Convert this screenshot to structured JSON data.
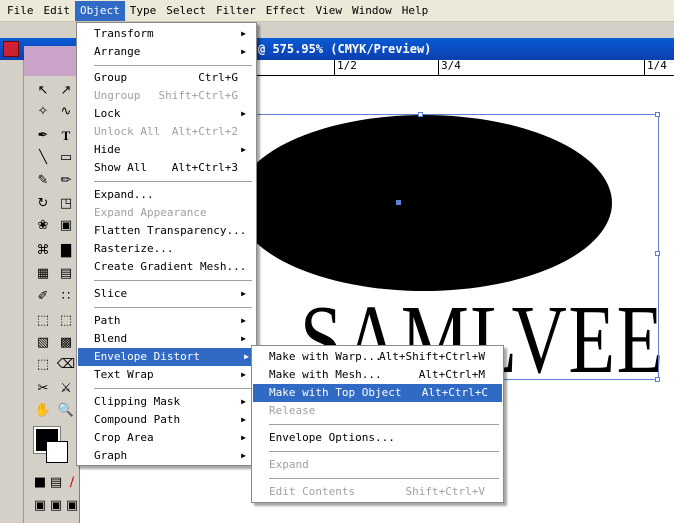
{
  "menubar": {
    "items": [
      "File",
      "Edit",
      "Object",
      "Type",
      "Select",
      "Filter",
      "Effect",
      "View",
      "Window",
      "Help"
    ],
    "active": "Object"
  },
  "document": {
    "title": "@ 575.95% (CMYK/Preview)",
    "ruler_labels": [
      "1/2",
      "3/4",
      "1/4"
    ],
    "canvas_text": "SAMLVEE"
  },
  "object_menu": {
    "items": [
      {
        "label": "Transform",
        "shortcut": "",
        "submenu": true,
        "disabled": false
      },
      {
        "label": "Arrange",
        "shortcut": "",
        "submenu": true,
        "disabled": false
      },
      {
        "label": "Group",
        "shortcut": "Ctrl+G",
        "submenu": false,
        "disabled": false
      },
      {
        "label": "Ungroup",
        "shortcut": "Shift+Ctrl+G",
        "submenu": false,
        "disabled": true
      },
      {
        "label": "Lock",
        "shortcut": "",
        "submenu": true,
        "disabled": false
      },
      {
        "label": "Unlock All",
        "shortcut": "Alt+Ctrl+2",
        "submenu": false,
        "disabled": true
      },
      {
        "label": "Hide",
        "shortcut": "",
        "submenu": true,
        "disabled": false
      },
      {
        "label": "Show All",
        "shortcut": "Alt+Ctrl+3",
        "submenu": false,
        "disabled": false
      },
      {
        "label": "Expand...",
        "shortcut": "",
        "submenu": false,
        "disabled": false
      },
      {
        "label": "Expand Appearance",
        "shortcut": "",
        "submenu": false,
        "disabled": true
      },
      {
        "label": "Flatten Transparency...",
        "shortcut": "",
        "submenu": false,
        "disabled": false
      },
      {
        "label": "Rasterize...",
        "shortcut": "",
        "submenu": false,
        "disabled": false
      },
      {
        "label": "Create Gradient Mesh...",
        "shortcut": "",
        "submenu": false,
        "disabled": false
      },
      {
        "label": "Slice",
        "shortcut": "",
        "submenu": true,
        "disabled": false
      },
      {
        "label": "Path",
        "shortcut": "",
        "submenu": true,
        "disabled": false
      },
      {
        "label": "Blend",
        "shortcut": "",
        "submenu": true,
        "disabled": false
      },
      {
        "label": "Envelope Distort",
        "shortcut": "",
        "submenu": true,
        "disabled": false,
        "highlighted": true
      },
      {
        "label": "Text Wrap",
        "shortcut": "",
        "submenu": true,
        "disabled": false
      },
      {
        "label": "Clipping Mask",
        "shortcut": "",
        "submenu": true,
        "disabled": false
      },
      {
        "label": "Compound Path",
        "shortcut": "",
        "submenu": true,
        "disabled": false
      },
      {
        "label": "Crop Area",
        "shortcut": "",
        "submenu": true,
        "disabled": false
      },
      {
        "label": "Graph",
        "shortcut": "",
        "submenu": true,
        "disabled": false
      }
    ]
  },
  "envelope_menu": {
    "items": [
      {
        "label": "Make with Warp...",
        "shortcut": "Alt+Shift+Ctrl+W",
        "disabled": false
      },
      {
        "label": "Make with Mesh...",
        "shortcut": "Alt+Ctrl+M",
        "disabled": false
      },
      {
        "label": "Make with Top Object",
        "shortcut": "Alt+Ctrl+C",
        "disabled": false,
        "highlighted": true
      },
      {
        "label": "Release",
        "shortcut": "",
        "disabled": true
      },
      {
        "label": "Envelope Options...",
        "shortcut": "",
        "disabled": false
      },
      {
        "label": "Expand",
        "shortcut": "",
        "disabled": true
      },
      {
        "label": "Edit Contents",
        "shortcut": "Shift+Ctrl+V",
        "disabled": true
      }
    ]
  },
  "colors": {
    "highlight": "#316ac5",
    "titlebar": "#0a5bd3",
    "selection": "#5d7fd6"
  }
}
